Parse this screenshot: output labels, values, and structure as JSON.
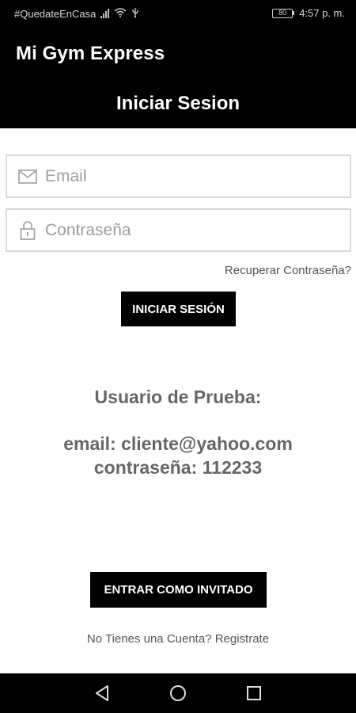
{
  "status_bar": {
    "hashtag": "#QuedateEnCasa",
    "battery": "80",
    "time": "4:57 p. m."
  },
  "app_bar": {
    "app_title": "Mi Gym Express",
    "page_title": "Iniciar Sesion"
  },
  "form": {
    "email_placeholder": "Email",
    "email_icon": "mail-icon",
    "password_placeholder": "Contraseña",
    "password_icon": "lock-icon",
    "recover_label": "Recuperar Contraseña?",
    "login_button": "INICIAR SESIÓN"
  },
  "demo_user": {
    "title": "Usuario de Prueba:",
    "email_line": "email: cliente@yahoo.com",
    "password_line": "contraseña: 112233"
  },
  "guest_button": "ENTRAR COMO INVITADO",
  "register_label": "No Tienes una Cuenta? Registrate",
  "navigation": {
    "back_icon": "back-triangle-icon",
    "home_icon": "home-circle-icon",
    "recents_icon": "recents-square-icon"
  }
}
